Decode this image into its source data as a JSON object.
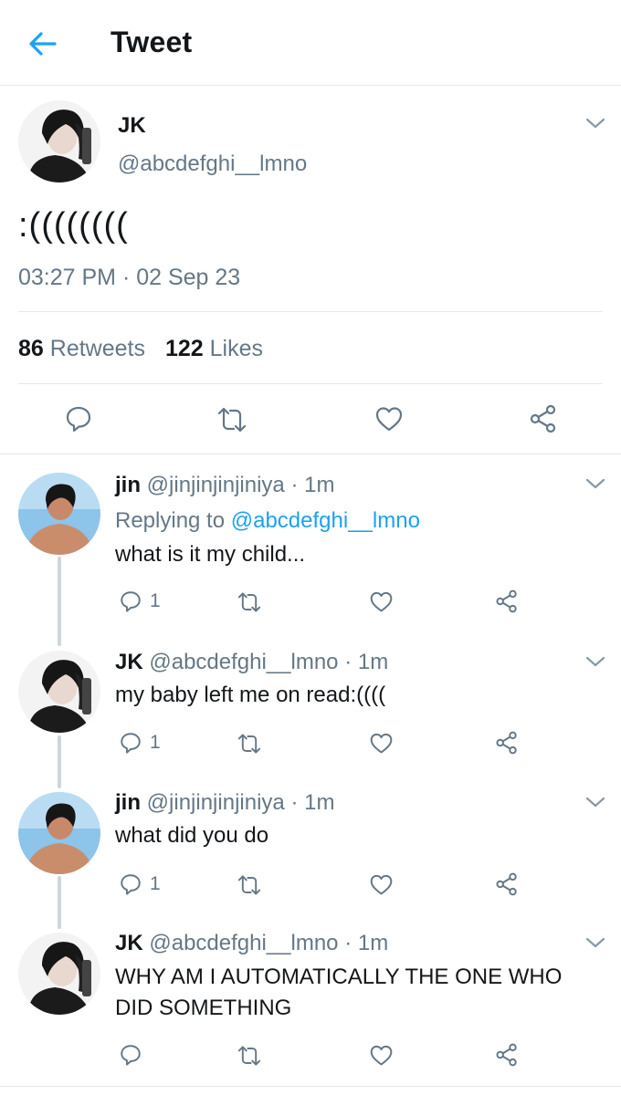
{
  "header": {
    "title": "Tweet",
    "back_icon": "arrow-left-icon",
    "accent": "#1da1f2"
  },
  "tweet": {
    "name": "JK",
    "handle": "@abcdefghi__lmno",
    "text": ":((((((((",
    "time": "03:27 PM · 02 Sep 23",
    "retweets_count": "86",
    "retweets_label": "Retweets",
    "likes_count": "122",
    "likes_label": "Likes",
    "actions": [
      "reply-icon",
      "retweet-icon",
      "heart-icon",
      "share-icon"
    ]
  },
  "replies": [
    {
      "name": "jin",
      "handle": "@jinjinjinjiniya",
      "time": "· 1m",
      "replying_prefix": "Replying to",
      "replying_to": "@abcdefghi__lmno",
      "text": "what is it my child...",
      "reply_count": "1"
    },
    {
      "name": "JK",
      "handle": "@abcdefghi__lmno",
      "time": "· 1m",
      "text": "my baby left me on read:((((",
      "reply_count": "1"
    },
    {
      "name": "jin",
      "handle": "@jinjinjinjiniya",
      "time": "· 1m",
      "text": "what did you do",
      "reply_count": "1"
    },
    {
      "name": "JK",
      "handle": "@abcdefghi__lmno",
      "time": "· 1m",
      "text_line1": "WHY AM I AUTOMATICALLY THE ONE WHO",
      "text_line2": "DID SOMETHING",
      "reply_count": ""
    }
  ]
}
